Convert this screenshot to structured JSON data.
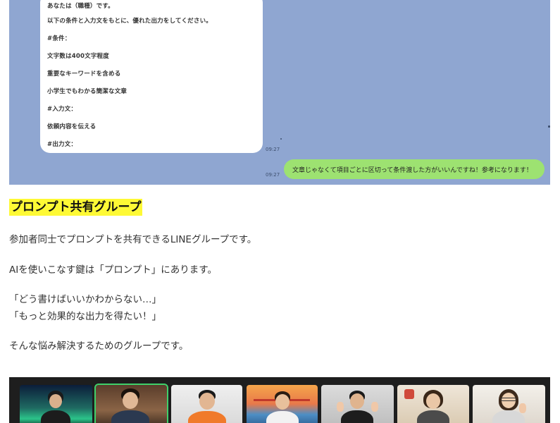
{
  "chat": {
    "bubble_lines": [
      "あなたは（職種）です。",
      "以下の条件と入力文をもとに、優れた出力をしてください。",
      "#条件：",
      "文字数は400文字程度",
      "重要なキーワードを含める",
      "小学生でもわかる簡潔な文章",
      "#入力文：",
      "依頼内容を伝える",
      "#出力文："
    ],
    "left_time": "09:27",
    "right_message": "文章じゃなくて項目ごとに区切って条件渡した方がいいんですね！参考になります！",
    "right_time": "09:27",
    "colors": {
      "background": "#8fa6d1",
      "own_bubble": "#9de271"
    }
  },
  "article": {
    "heading": "プロンプト共有グループ",
    "heading_highlight": "#fef935",
    "p1": "参加者同士でプロンプトを共有できるLINEグループです。",
    "p2": "AIを使いこなす鍵は「プロンプト」にあります。",
    "p3a": "「どう書けばいいかわからない…」",
    "p3b": "「もっと効果的な出力を得たい！」",
    "p4": "そんな悩み解決するためのグループです。"
  },
  "video_call": {
    "participant_count": 7
  }
}
